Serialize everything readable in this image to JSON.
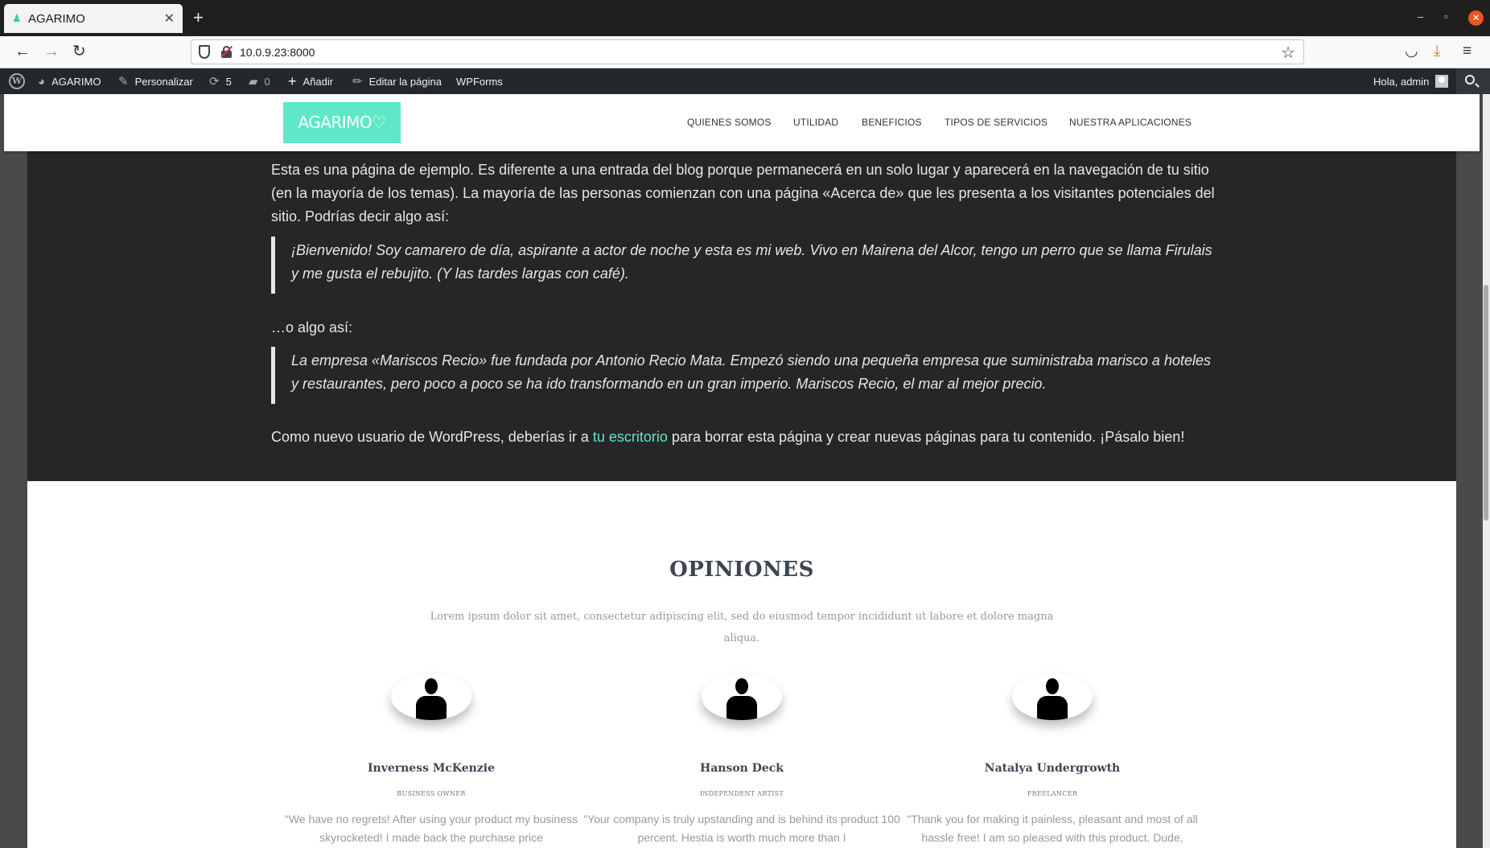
{
  "browser": {
    "tab_title": "AGARIMO",
    "tab_close": "✕",
    "new_tab": "+",
    "url": "10.0.9.23:8000",
    "window_controls": {
      "minimize": "–",
      "restore": "▫",
      "close": "✕"
    }
  },
  "adminbar": {
    "site_name": "AGARIMO",
    "customize": "Personalizar",
    "updates_count": "5",
    "comments_count": "0",
    "add_new": "Añadir",
    "edit_page": "Editar la página",
    "wpforms": "WPForms",
    "greeting": "Hola, admin"
  },
  "site": {
    "logo_text": "AGARIMO♡",
    "menu": [
      "QUIENES SOMOS",
      "UTILIDAD",
      "BENEFICIOS",
      "TIPOS DE SERVICIOS",
      "NUESTRA APLICACIONES"
    ]
  },
  "content": {
    "intro": "Esta es una página de ejemplo. Es diferente a una entrada del blog porque permanecerá en un solo lugar y aparecerá en la navegación de tu sitio (en la mayoría de los temas). La mayoría de las personas comienzan con una página «Acerca de» que les presenta a los visitantes potenciales del sitio. Podrías decir algo así:",
    "quote1": "¡Bienvenido! Soy camarero de día, aspirante a actor de noche y esta es mi web. Vivo en Mairena del Alcor, tengo un perro que se llama Firulais y me gusta el rebujito. (Y las tardes largas con café).",
    "middle": "…o algo así:",
    "quote2": "La empresa «Mariscos Recio» fue fundada por Antonio Recio Mata. Empezó siendo una pequeña empresa que suministraba marisco a hoteles y restaurantes, pero poco a poco se ha ido transformando en un gran imperio. Mariscos Recio, el mar al mejor precio.",
    "outro_before": "Como nuevo usuario de WordPress, deberías ir a ",
    "outro_link": "tu escritorio",
    "outro_after": " para borrar esta página y crear nuevas páginas para tu contenido. ¡Pásalo bien!"
  },
  "testimonials": {
    "title": "OPINIONES",
    "subtitle": "Lorem ipsum dolor sit amet, consectetur adipiscing elit, sed do eiusmod tempor incididunt ut labore et dolore magna aliqua.",
    "items": [
      {
        "name": "Inverness McKenzie",
        "role": "BUSINESS OWNER",
        "text": "\"We have no regrets! After using your product my business skyrocketed! I made back the purchase price"
      },
      {
        "name": "Hanson Deck",
        "role": "INDEPENDENT ARTIST",
        "text": "\"Your company is truly upstanding and is behind its product 100 percent. Hestia is worth much more than I"
      },
      {
        "name": "Natalya Undergrowth",
        "role": "FREELANCER",
        "text": "\"Thank you for making it painless, pleasant and most of all hassle free! I am so pleased with this product. Dude,"
      }
    ]
  },
  "colors": {
    "accent": "#5ee8c8",
    "dark_bg": "#262626",
    "admin_bar": "#23282d"
  }
}
